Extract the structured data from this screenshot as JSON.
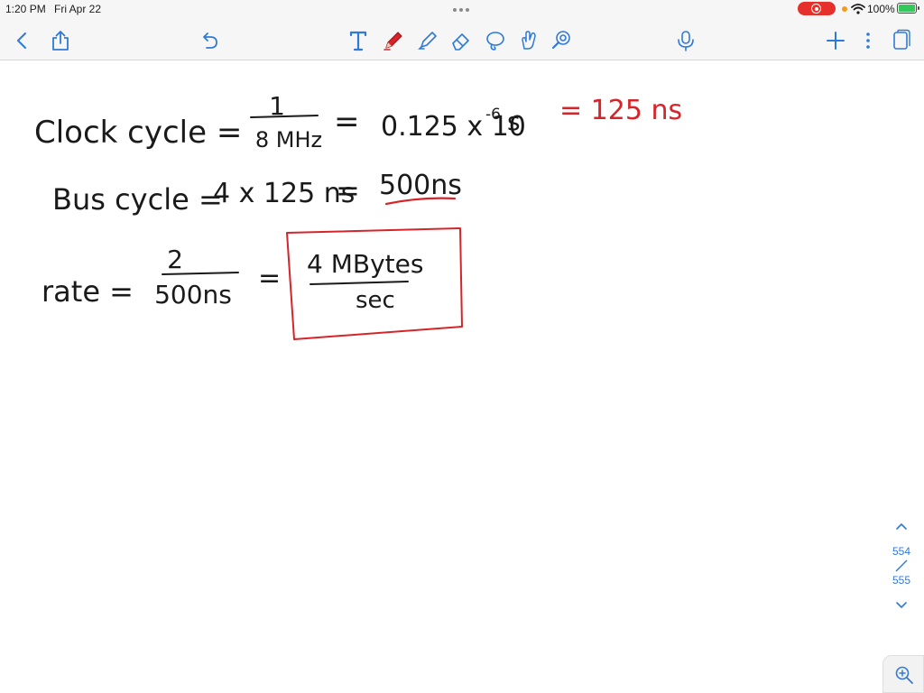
{
  "status_bar": {
    "time": "1:20 PM",
    "date": "Fri Apr 22",
    "battery": "100%"
  },
  "toolbar": {
    "left_icons": [
      "chevron-left-icon",
      "share-icon",
      "undo-icon"
    ],
    "tools": [
      "text-tool-icon",
      "pen-tool-icon",
      "highlighter-icon",
      "eraser-icon",
      "lasso-icon",
      "shape-icon",
      "laser-pointer-icon"
    ],
    "right_icons": [
      "microphone-icon",
      "plus-icon",
      "more-icon",
      "pages-icon"
    ],
    "accent": "#2f7ad8",
    "active_tool_color": "#d6252a"
  },
  "note": {
    "line1": {
      "label": "Clock cycle =",
      "numerator": "1",
      "denominator": "8 MHz",
      "equals": "=",
      "value": "0.125 x 10",
      "exponent": "-6",
      "unit": "s",
      "red_result": "= 125 ns"
    },
    "line2": {
      "label": "Bus cycle =",
      "expr": "4 x 125 ns",
      "equals": "=",
      "result": "500ns"
    },
    "line3": {
      "label": "rate =",
      "numerator": "2",
      "denominator": "500ns",
      "equals": "=",
      "box_numerator": "4 MBytes",
      "box_denominator": "sec"
    },
    "ink_color": "#1a1a1a",
    "red_ink_color": "#d6252a"
  },
  "pager": {
    "current": "554",
    "separator": "/",
    "total": "555"
  }
}
